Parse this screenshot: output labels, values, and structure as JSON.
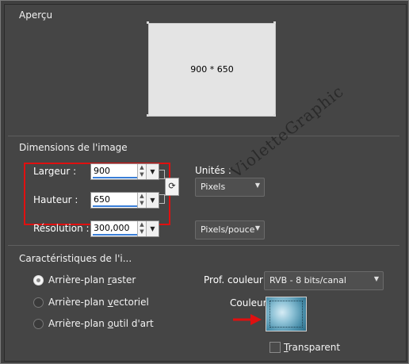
{
  "preview": {
    "title": "Aperçu",
    "size_label": "900 * 650"
  },
  "dimensions": {
    "title": "Dimensions de l'image",
    "width_label": "Largeur :",
    "width_value": "900",
    "height_label": "Hauteur :",
    "height_value": "650",
    "resolution_label": "Résolution :",
    "resolution_value": "300,000",
    "units_label": "Unités :",
    "units_value": "Pixels",
    "res_units_value": "Pixels/pouce"
  },
  "characteristics": {
    "title": "Caractéristiques de l'i...",
    "options": [
      {
        "pre": "Arrière-plan ",
        "u": "r",
        "post": "aster",
        "selected": true
      },
      {
        "pre": "Arrière-plan ",
        "u": "v",
        "post": "ectoriel",
        "selected": false
      },
      {
        "pre": "Arrière-plan ",
        "u": "o",
        "post": "util d'art",
        "selected": false
      }
    ],
    "depth_label": "Prof. couleur:",
    "depth_value": "RVB - 8 bits/canal",
    "color_label": "Couleur :",
    "transparent_label_u": "T",
    "transparent_label_rest": "ransparent",
    "transparent_checked": false
  },
  "watermark": "VioletteGraphic",
  "colors": {
    "highlight": "#e01010",
    "accent": "#3a7fd8"
  },
  "icons": {
    "spin_up": "▲",
    "spin_down": "▼",
    "dropdown": "▼",
    "link": "⟳"
  }
}
